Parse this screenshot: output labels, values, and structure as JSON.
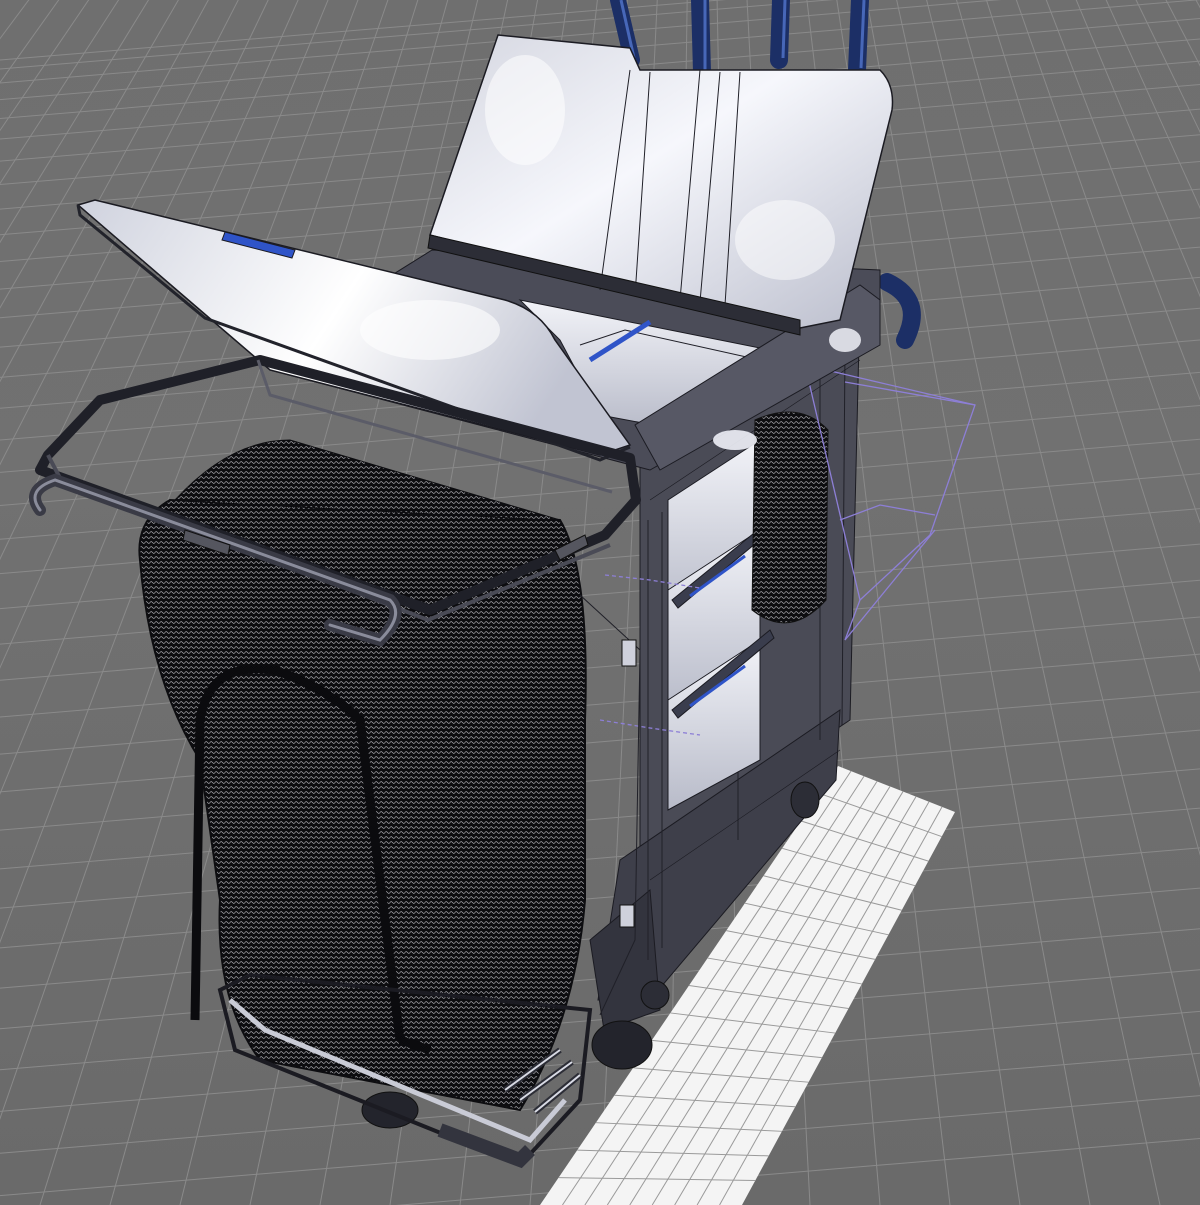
{
  "viewport": {
    "background": "#6d6d6d",
    "grid_line_color": "#8a8a8a",
    "ground_tile_color": "#ffffff",
    "selection_box_color": "#8d7fd6",
    "handle_accent_color": "#2f54c8",
    "mesh_dark_color": "#1a1a1f",
    "surface_light_color": "#e6e8f2"
  },
  "scene": {
    "object": "cleaning-cart",
    "display_mode": "shaded-with-wireframe",
    "icons": [
      "selection-bounding-box",
      "ground-shadow-grid"
    ]
  }
}
